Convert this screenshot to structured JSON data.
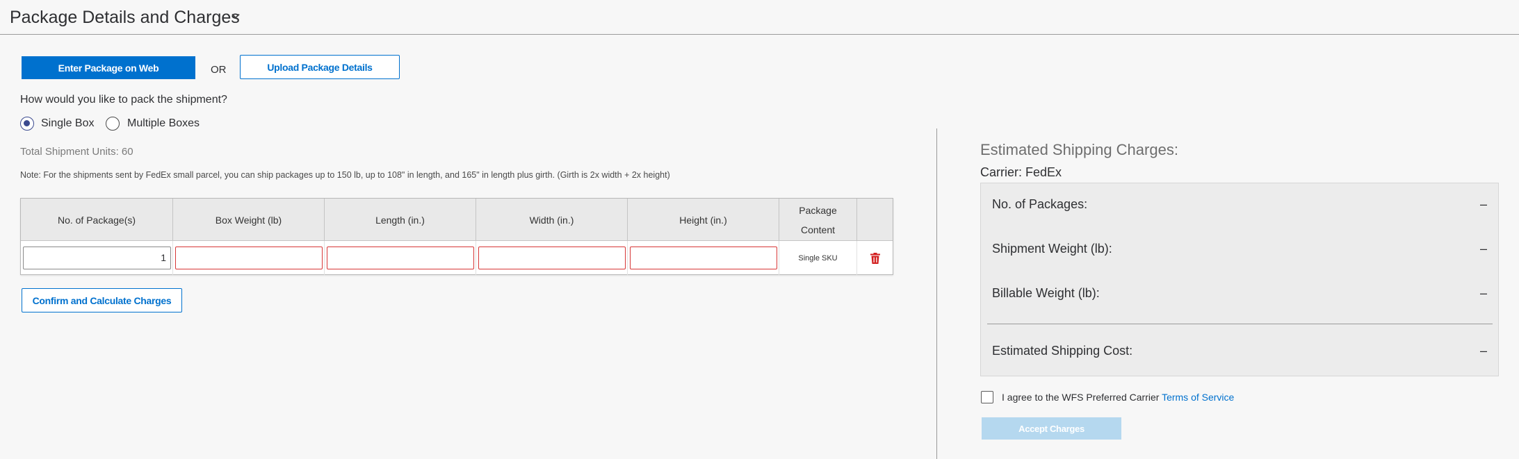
{
  "header": {
    "title": "Package Details and Charges",
    "collapse_icon": "chevron-down-icon"
  },
  "entry": {
    "web_label": "Enter Package on Web",
    "or_label": "OR",
    "upload_label": "Upload Package Details"
  },
  "packing": {
    "question": "How would you like to pack the shipment?",
    "options": [
      {
        "label": "Single Box",
        "selected": true
      },
      {
        "label": "Multiple Boxes",
        "selected": false
      }
    ]
  },
  "units_text": "Total Shipment Units: 60",
  "note": "Note: For the shipments sent by FedEx small parcel, you can ship packages up to 150 lb, up to 108\" in length, and 165\" in length plus girth. (Girth is 2x width + 2x height)",
  "table": {
    "headers": [
      "No. of Package(s)",
      "Box Weight (lb)",
      "Length (in.)",
      "Width (in.)",
      "Height (in.)",
      "Package Content"
    ],
    "row": {
      "packages": "1",
      "box_weight": "",
      "length": "",
      "width": "",
      "height": "",
      "content": "Single SKU",
      "delete_icon": "trash-icon"
    },
    "error_color": "#d73636"
  },
  "confirm_label": "Confirm and Calculate Charges",
  "estimate": {
    "title": "Estimated Shipping Charges:",
    "carrier": "Carrier: FedEx",
    "rows": [
      {
        "label": "No. of Packages:",
        "value": "–"
      },
      {
        "label": "Shipment Weight (lb):",
        "value": "–"
      },
      {
        "label": "Billable Weight (lb):",
        "value": "–"
      },
      {
        "label": "Estimated Shipping Cost:",
        "value": "–"
      }
    ]
  },
  "agreement": {
    "text": "I agree to the WFS Preferred Carrier",
    "link": "Terms of Service",
    "checked": false
  },
  "accept_label": "Accept Charges",
  "colors": {
    "primary": "#0071ce",
    "disabled": "#b5d8ef",
    "error": "#d73636"
  }
}
